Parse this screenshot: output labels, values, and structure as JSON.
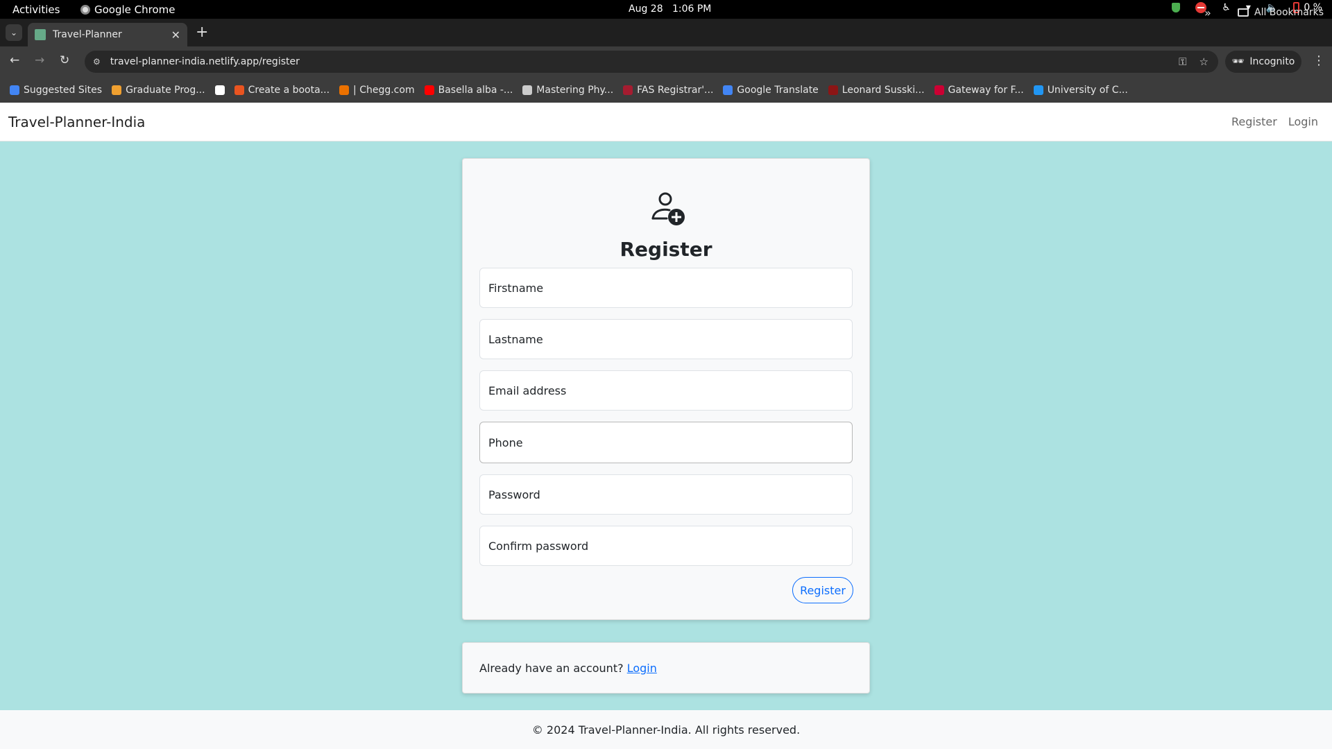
{
  "system_bar": {
    "activities": "Activities",
    "app_name": "Google Chrome",
    "date": "Aug 28",
    "time": "1:06 PM",
    "battery": "0 %"
  },
  "browser": {
    "tab_title": "Travel-Planner",
    "url": "travel-planner-india.netlify.app/register",
    "incognito_label": "Incognito",
    "bookmarks": [
      {
        "label": "Suggested Sites",
        "color": "#4285f4"
      },
      {
        "label": "Graduate Prog...",
        "color": "#f0a030"
      },
      {
        "label": "",
        "color": "#ffffff"
      },
      {
        "label": "Create a boota...",
        "color": "#e95420"
      },
      {
        "label": "| Chegg.com",
        "color": "#eb7100"
      },
      {
        "label": "Basella alba -...",
        "color": "#ff0000"
      },
      {
        "label": "Mastering Phy...",
        "color": "#cccccc"
      },
      {
        "label": "FAS Registrar'...",
        "color": "#a51c30"
      },
      {
        "label": "Google Translate",
        "color": "#4285f4"
      },
      {
        "label": "Leonard Susski...",
        "color": "#8c1515"
      },
      {
        "label": "Gateway for F...",
        "color": "#cc0033"
      },
      {
        "label": "University of C...",
        "color": "#2196f3"
      }
    ],
    "all_bookmarks": "All Bookmarks"
  },
  "site_nav": {
    "brand": "Travel-Planner-India",
    "links": [
      "Register",
      "Login"
    ]
  },
  "register_form": {
    "title": "Register",
    "fields": {
      "firstname": "Firstname",
      "lastname": "Lastname",
      "email": "Email address",
      "phone": "Phone",
      "password": "Password",
      "confirm_password": "Confirm password"
    },
    "submit_label": "Register"
  },
  "login_prompt": {
    "text": "Already have an account?",
    "link": "Login"
  },
  "footer": {
    "text": "© 2024 Travel-Planner-India. All rights reserved."
  },
  "colors": {
    "page_background": "#ace2e1",
    "accent": "#0d6efd"
  }
}
